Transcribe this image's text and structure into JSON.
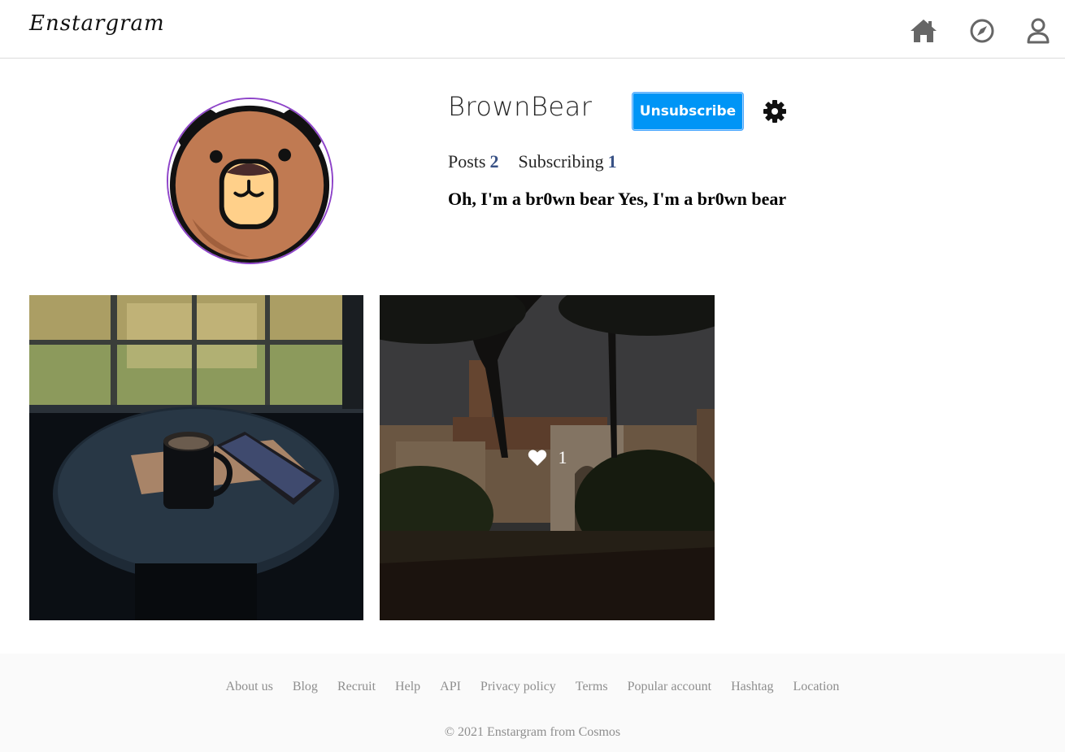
{
  "header": {
    "logo": "Enstargram",
    "nav_icons": [
      "home-icon",
      "explore-compass-icon",
      "profile-user-icon"
    ]
  },
  "profile": {
    "username": "BrownBear",
    "action_button": "Unsubscribe",
    "posts_label": "Posts",
    "posts_count": "2",
    "subscribing_label": "Subscribing",
    "subscribing_count": "1",
    "bio": "Oh, I'm a br0wn bear Yes, I'm a br0wn bear"
  },
  "posts": [
    {
      "subject": "coffee-and-phone-photo"
    },
    {
      "subject": "ruins-and-trees-photo",
      "likes": "1"
    }
  ],
  "footer": {
    "links": [
      "About us",
      "Blog",
      "Recruit",
      "Help",
      "API",
      "Privacy policy",
      "Terms",
      "Popular account",
      "Hashtag",
      "Location"
    ],
    "copyright": "© 2021 Enstargram from Cosmos"
  },
  "colors": {
    "accent": "#0095f6",
    "avatar_ring": "#8e44c9",
    "stat_number": "#385185"
  }
}
